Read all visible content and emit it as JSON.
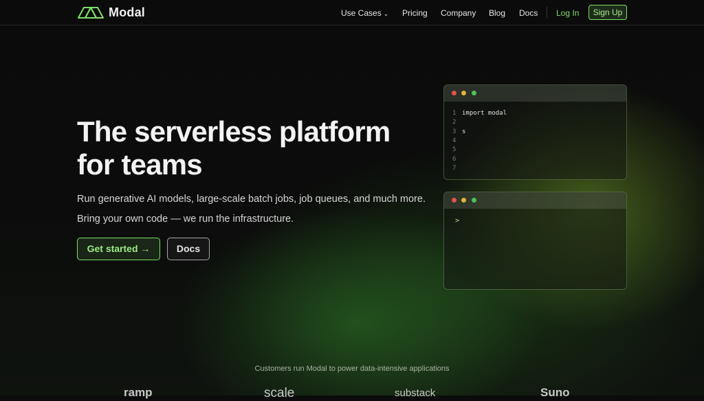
{
  "brand": {
    "name": "Modal"
  },
  "nav": {
    "items": [
      "Use Cases",
      "Pricing",
      "Company",
      "Blog",
      "Docs"
    ],
    "login": "Log In",
    "signup": "Sign Up"
  },
  "hero": {
    "title_line1": "The serverless platform",
    "title_line2": "for teams",
    "subtitle1": "Run generative AI models, large-scale batch jobs, job queues, and much more.",
    "subtitle2": "Bring your own code — we run the infrastructure.",
    "primary_button": "Get started →",
    "secondary_button": "Docs"
  },
  "editor": {
    "lines": [
      {
        "num": "1",
        "code": "import modal"
      },
      {
        "num": "2",
        "code": ""
      },
      {
        "num": "3",
        "code": "s"
      },
      {
        "num": "4",
        "code": ""
      },
      {
        "num": "5",
        "code": ""
      },
      {
        "num": "6",
        "code": ""
      },
      {
        "num": "7",
        "code": ""
      }
    ]
  },
  "terminal": {
    "prompt": ">"
  },
  "customers": {
    "caption": "Customers run Modal to power data-intensive applications",
    "logos": [
      "ramp",
      "scale",
      "substack",
      "Suno"
    ]
  },
  "colors": {
    "accent_green": "#7fe06a",
    "dot_red": "#e5534b",
    "dot_yellow": "#e0b43a",
    "dot_green": "#4fc25a"
  }
}
